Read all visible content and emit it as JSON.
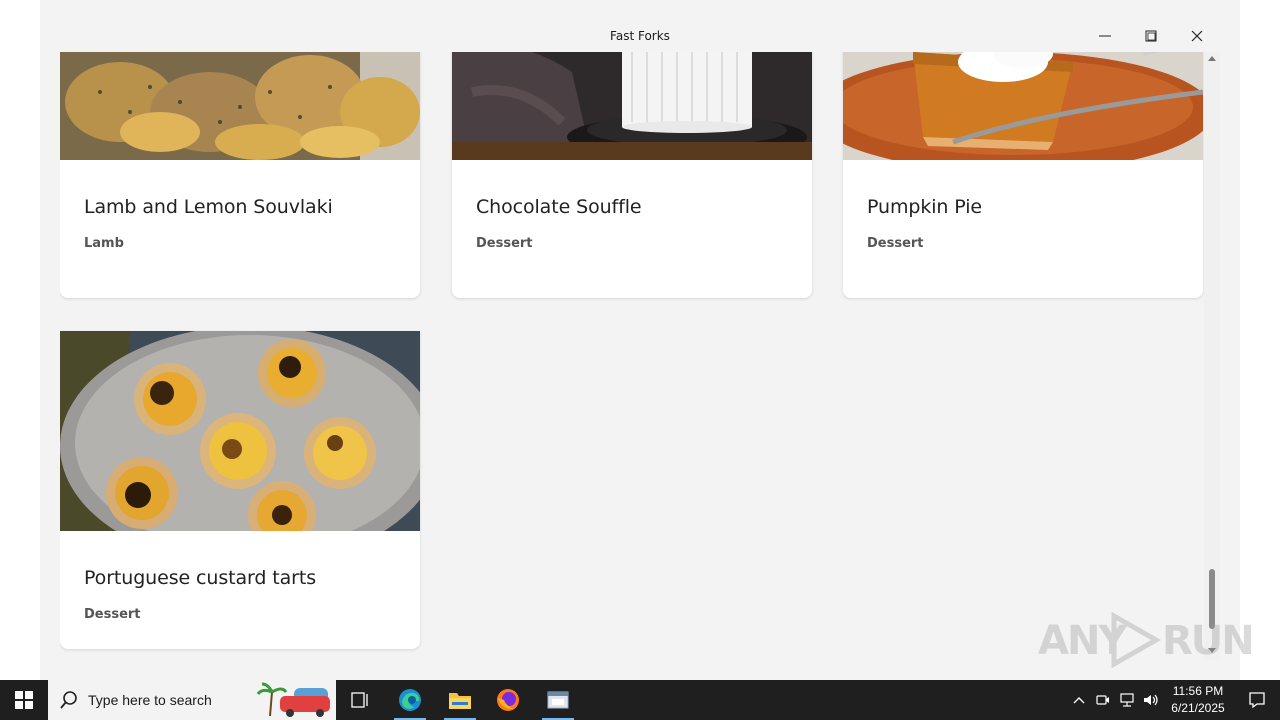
{
  "window": {
    "title": "Fast Forks"
  },
  "recipes": [
    {
      "name": "Lamb and Lemon Souvlaki",
      "category": "Lamb",
      "image_icon": "roast-lamb-photo"
    },
    {
      "name": "Chocolate Souffle",
      "category": "Dessert",
      "image_icon": "chocolate-souffle-photo"
    },
    {
      "name": "Pumpkin Pie",
      "category": "Dessert",
      "image_icon": "pumpkin-pie-photo"
    },
    {
      "name": "Portuguese custard tarts",
      "category": "Dessert",
      "image_icon": "custard-tarts-photo"
    }
  ],
  "taskbar": {
    "search_placeholder": "Type here to search",
    "time": "11:56 PM",
    "date": "6/21/2025"
  },
  "watermark": {
    "text_left": "ANY",
    "text_right": "RUN"
  },
  "colors": {
    "accent": "#76b9ed",
    "taskbar": "#1f1f1f",
    "card": "#ffffff",
    "background": "#f3f3f3"
  }
}
